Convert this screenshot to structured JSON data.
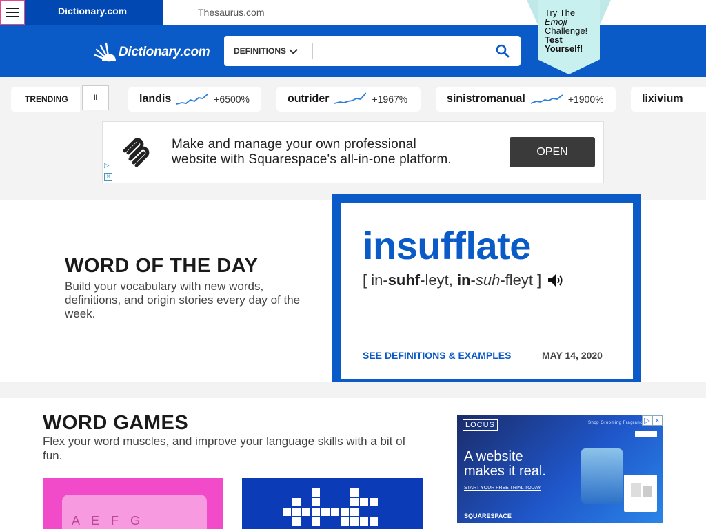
{
  "tabs": {
    "dictionary": "Dictionary.com",
    "thesaurus": "Thesaurus.com"
  },
  "header": {
    "logo": "Dictionary.com",
    "search_scope": "DEFINITIONS",
    "search_value": ""
  },
  "badge": {
    "lines": [
      "Try The",
      "Emoji",
      "Challenge!",
      "Test",
      "Yourself!"
    ]
  },
  "trending": {
    "label": "TRENDING",
    "pause": "II",
    "items": [
      {
        "word": "landis",
        "change": "+6500%"
      },
      {
        "word": "outrider",
        "change": "+1967%"
      },
      {
        "word": "sinistromanual",
        "change": "+1900%"
      },
      {
        "word": "lixivium"
      }
    ]
  },
  "ad": {
    "line1": "Make and manage your own professional",
    "line2": "website with Squarespace's all-in-one platform.",
    "cta": "OPEN"
  },
  "wotd": {
    "heading": "WORD OF THE DAY",
    "blurb": "Build your vocabulary with new words, definitions, and origin stories every day of the week.",
    "word": "insufflate",
    "pron_open": "[ in-",
    "pron_s1": "suhf",
    "pron_m1": "-leyt, ",
    "pron_s2": "in",
    "pron_m2": "-",
    "pron_s3": "suh",
    "pron_close": "-fleyt ]",
    "see_link": "SEE DEFINITIONS & EXAMPLES",
    "date": "MAY 14, 2020"
  },
  "games": {
    "heading": "WORD GAMES",
    "blurb": "Flex your word muscles, and improve your language skills with a bit of fun.",
    "card_letters": "A E F G"
  },
  "sidead": {
    "brand_tag": "LOCUS",
    "nav": "Shop   Grooming   Fragrances",
    "headline1": "A website",
    "headline2": "makes it real.",
    "trial": "START YOUR FREE TRIAL TODAY",
    "brand": "SQUARESPACE"
  },
  "colors": {
    "brand_blue": "#0a5ac7",
    "dark_blue": "#0248b3",
    "ad_pink": "#f24bc9"
  }
}
